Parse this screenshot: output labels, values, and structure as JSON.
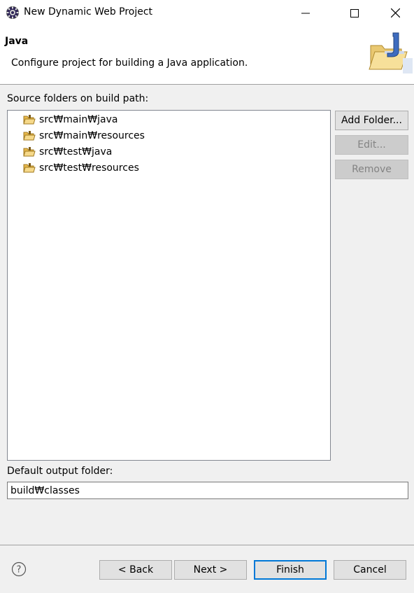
{
  "window": {
    "title": "New Dynamic Web Project",
    "icon": "eclipse-gear-icon",
    "controls": [
      "minimize-icon",
      "maximize-icon",
      "close-icon"
    ]
  },
  "header": {
    "title": "Java",
    "description": "Configure project for building a Java application.",
    "image": "java-folder-wizard-icon"
  },
  "source_folders": {
    "label": "Source folders on build path:",
    "items": [
      {
        "label": "src₩main₩java",
        "icon": "source-folder-icon"
      },
      {
        "label": "src₩main₩resources",
        "icon": "source-folder-icon"
      },
      {
        "label": "src₩test₩java",
        "icon": "source-folder-icon"
      },
      {
        "label": "src₩test₩resources",
        "icon": "source-folder-icon"
      }
    ],
    "buttons": {
      "add": "Add Folder...",
      "edit": "Edit...",
      "remove": "Remove"
    }
  },
  "output": {
    "label": "Default output folder:",
    "value": "build₩classes"
  },
  "footer": {
    "help_icon": "help-icon",
    "back": "< Back",
    "next": "Next >",
    "finish": "Finish",
    "cancel": "Cancel"
  },
  "colors": {
    "default_button_border": "#0078d7",
    "disabled_text": "#838383",
    "folder": "#e8b84a"
  }
}
